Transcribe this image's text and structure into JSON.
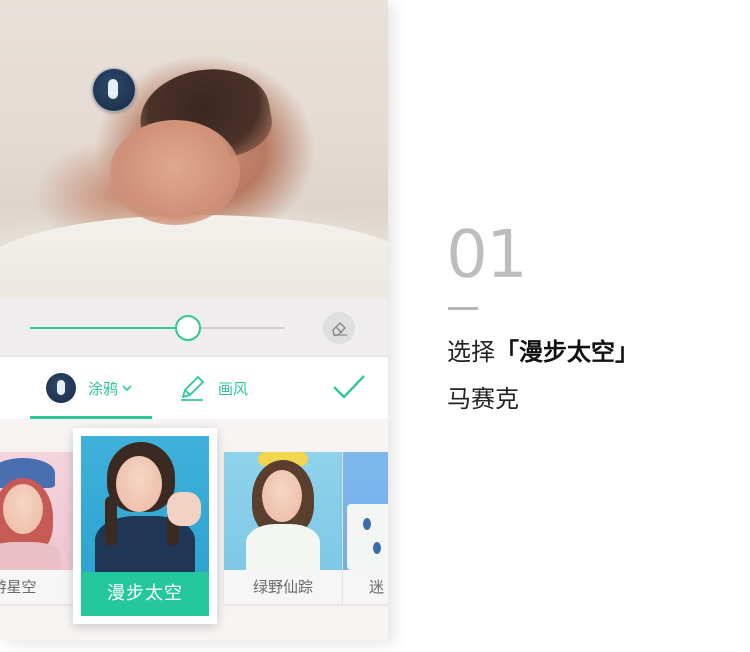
{
  "editor": {
    "slider": {
      "value_fraction": 0.62
    },
    "toolbar": {
      "brush_label": "涂鸦",
      "style_label": "画风"
    },
    "filters": [
      {
        "label": "游星空",
        "selected": false
      },
      {
        "label": "漫步太空",
        "selected": true
      },
      {
        "label": "绿野仙踪",
        "selected": false
      },
      {
        "label": "迷",
        "selected": false
      }
    ]
  },
  "step": {
    "number": "01",
    "line1_prefix": "选择",
    "line1_highlight": "「漫步太空」",
    "line2": "马赛克"
  },
  "colors": {
    "accent": "#2fc79a",
    "selected_label_bg": "#25c89d"
  }
}
